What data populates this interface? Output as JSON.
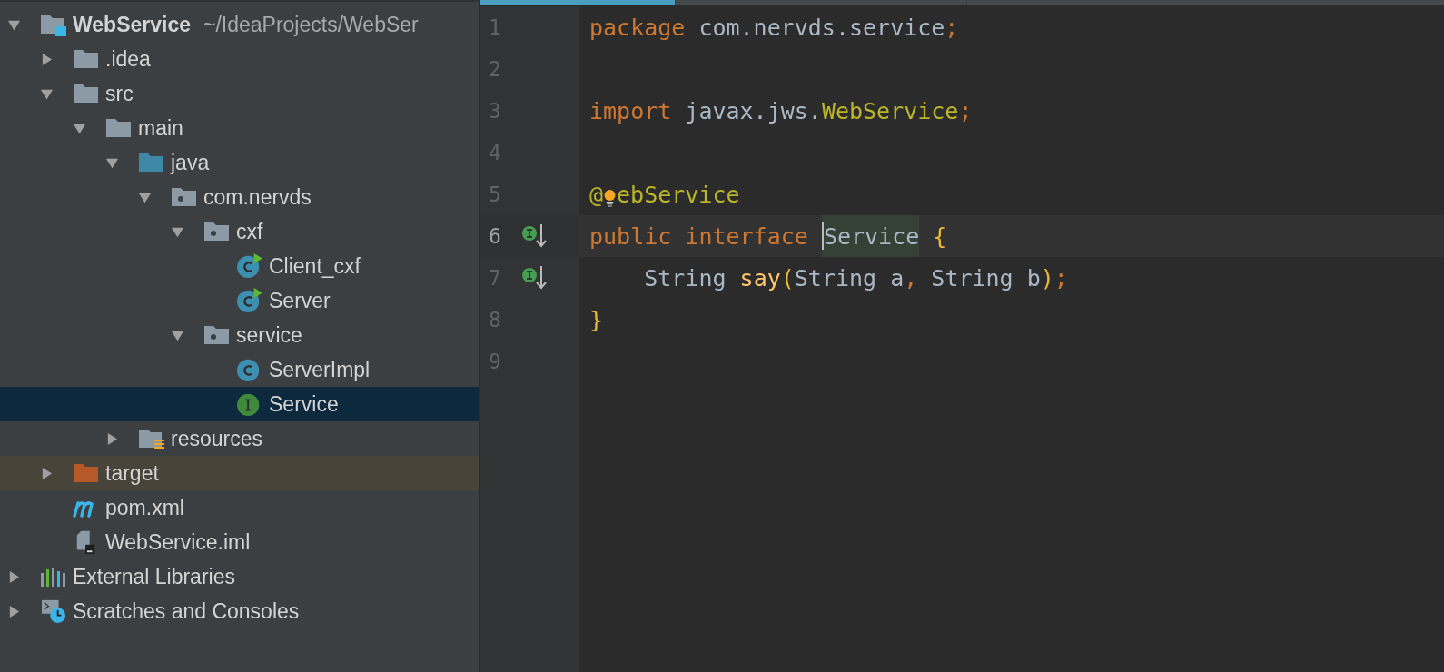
{
  "project_tree": [
    {
      "label": "WebService",
      "path": "~/IdeaProjects/WebSer",
      "kind": "module",
      "expanded": true,
      "selected": false,
      "excluded": false,
      "children": [
        {
          "label": ".idea",
          "kind": "folder",
          "expanded": false,
          "selected": false,
          "excluded": false
        },
        {
          "label": "src",
          "kind": "folder",
          "expanded": true,
          "selected": false,
          "excluded": false,
          "children": [
            {
              "label": "main",
              "kind": "folder",
              "expanded": true,
              "selected": false,
              "excluded": false,
              "children": [
                {
                  "label": "java",
                  "kind": "source-folder",
                  "expanded": true,
                  "selected": false,
                  "excluded": false,
                  "children": [
                    {
                      "label": "com.nervds",
                      "kind": "package",
                      "expanded": true,
                      "selected": false,
                      "excluded": false,
                      "children": [
                        {
                          "label": "cxf",
                          "kind": "package",
                          "expanded": true,
                          "selected": false,
                          "excluded": false,
                          "children": [
                            {
                              "label": "Client_cxf",
                              "kind": "runnable-class",
                              "selected": false,
                              "excluded": false
                            },
                            {
                              "label": "Server",
                              "kind": "runnable-class",
                              "selected": false,
                              "excluded": false
                            }
                          ]
                        },
                        {
                          "label": "service",
                          "kind": "package",
                          "expanded": true,
                          "selected": false,
                          "excluded": false,
                          "children": [
                            {
                              "label": "ServerImpl",
                              "kind": "class",
                              "selected": false,
                              "excluded": false
                            },
                            {
                              "label": "Service",
                              "kind": "interface",
                              "selected": true,
                              "excluded": false
                            }
                          ]
                        }
                      ]
                    }
                  ]
                },
                {
                  "label": "resources",
                  "kind": "resources-folder",
                  "expanded": false,
                  "selected": false,
                  "excluded": false
                }
              ]
            }
          ]
        },
        {
          "label": "target",
          "kind": "excluded-folder",
          "expanded": false,
          "selected": false,
          "excluded": true
        },
        {
          "label": "pom.xml",
          "kind": "maven",
          "selected": false,
          "excluded": false
        },
        {
          "label": "WebService.iml",
          "kind": "iml",
          "selected": false,
          "excluded": false
        }
      ]
    },
    {
      "label": "External Libraries",
      "kind": "libraries",
      "expanded": false,
      "selected": false,
      "excluded": false
    },
    {
      "label": "Scratches and Consoles",
      "kind": "scratches",
      "expanded": false,
      "selected": false,
      "excluded": false
    }
  ],
  "editor_tabs": [
    {
      "selected": true
    },
    {
      "selected": false
    },
    {
      "selected": false
    }
  ],
  "code_lines": [
    {
      "number": "1",
      "current": false,
      "tokens": [
        {
          "kind": "keyword",
          "text": "package"
        },
        {
          "kind": "plain",
          "text": " com.nervds.service"
        },
        {
          "kind": "punct",
          "text": ";"
        }
      ]
    },
    {
      "number": "2",
      "current": false
    },
    {
      "number": "3",
      "current": false,
      "tokens": [
        {
          "kind": "keyword",
          "text": "import"
        },
        {
          "kind": "plain",
          "text": " javax.jws."
        },
        {
          "kind": "annotation",
          "text": "WebService"
        },
        {
          "kind": "punct",
          "text": ";"
        }
      ]
    },
    {
      "number": "4",
      "current": false
    },
    {
      "number": "5",
      "current": false,
      "intention_bulb": true,
      "tokens": [
        {
          "kind": "annotation",
          "text": "@"
        },
        {
          "kind": "annotation",
          "text": "ebService"
        }
      ]
    },
    {
      "number": "6",
      "current": true,
      "implemented_marker": true,
      "tokens": [
        {
          "kind": "keyword",
          "text": "public interface "
        },
        {
          "kind": "usage",
          "text": "Service",
          "caret": true
        },
        {
          "kind": "bracket",
          "text": " {"
        }
      ]
    },
    {
      "number": "7",
      "current": false,
      "implemented_marker": true,
      "tokens": [
        {
          "kind": "plain",
          "text": "    String "
        },
        {
          "kind": "method",
          "text": "say"
        },
        {
          "kind": "bracket",
          "text": "("
        },
        {
          "kind": "plain",
          "text": "String a"
        },
        {
          "kind": "punct",
          "text": ","
        },
        {
          "kind": "plain",
          "text": " String b"
        },
        {
          "kind": "bracket",
          "text": ")"
        },
        {
          "kind": "punct",
          "text": ";"
        }
      ]
    },
    {
      "number": "8",
      "current": false,
      "tokens": [
        {
          "kind": "bracket",
          "text": "}"
        }
      ]
    },
    {
      "number": "9",
      "current": false
    }
  ]
}
